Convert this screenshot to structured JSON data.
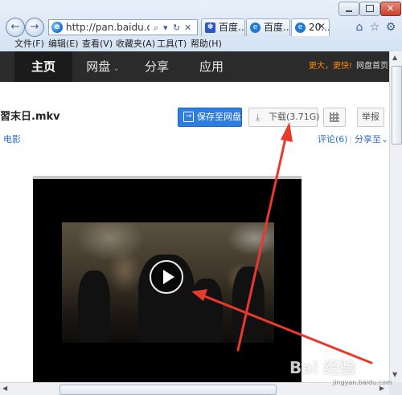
{
  "browser": {
    "address_url": "http://pan.baidu.com/pclo",
    "address_controls": [
      "⌕",
      "▾",
      "↻",
      "✕"
    ],
    "tabs": [
      {
        "label": "百度..."
      },
      {
        "label": "百度..."
      },
      {
        "label": "20..."
      }
    ],
    "menu": [
      "文件(F)",
      "编辑(E)",
      "查看(V)",
      "收藏夹(A)",
      "工具(T)",
      "帮助(H)"
    ]
  },
  "topnav": {
    "items": [
      "主页",
      "网盘",
      "分享",
      "应用"
    ],
    "promo": "更大，更快!",
    "disk_home": "网盘首页"
  },
  "file": {
    "title": "習末日.mkv",
    "category": "电影"
  },
  "actions": {
    "save_label": "保存至网盘",
    "download_label": "下载(3.71G)",
    "report_label": "举报"
  },
  "meta": {
    "comments_label": "评论(6)",
    "share_to_label": "分享至"
  },
  "watermark": {
    "text": "Bai 经验",
    "sub": "jingyan.baidu.com"
  },
  "colors": {
    "annotation_red": "#e8392e",
    "nav_bg": "#2b2b2b",
    "save_button": "#2d7ee0",
    "promo": "#ff8a00"
  }
}
